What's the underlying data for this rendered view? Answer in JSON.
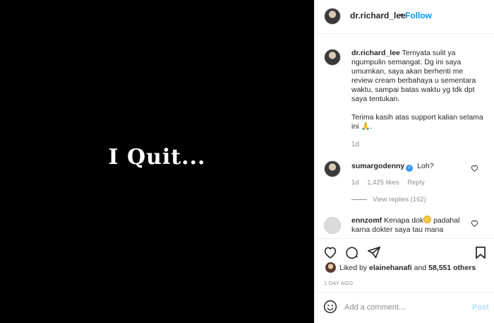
{
  "post_image": {
    "text": "I Quit..."
  },
  "header": {
    "username": "dr.richard_lee",
    "separator": "•",
    "follow_label": "Follow"
  },
  "caption": {
    "username": "dr.richard_lee",
    "text": "Ternyata sulit ya ngumpulin semangat. Dg ini saya umumkan, saya akan berhenti me review cream berbahaya u sementara waktu, sampai batas waktu yg tdk dpt saya tentukan.",
    "text2": "Terima kasih atas support kalian selama ini",
    "emoji": "🙏",
    "text2_end": ".",
    "time": "1d"
  },
  "comments": [
    {
      "username": "sumargodenny",
      "verified_mark": "✓",
      "text": "Loh?",
      "time": "1d",
      "likes": "1,425 likes",
      "reply_label": "Reply",
      "view_replies": "View replies (162)"
    },
    {
      "username": "ennzomf",
      "text_before": "Kenapa dok",
      "text_after": "padahal karna dokter saya tau mana"
    }
  ],
  "actions": {
    "likes_prefix": "Liked by",
    "likes_user": "elainehanafi",
    "likes_and": "and",
    "likes_count": "58,551 others",
    "time": "1 DAY AGO"
  },
  "comment_box": {
    "placeholder": "Add a comment...",
    "post_label": "Post"
  },
  "icons": {
    "like": "heart-icon",
    "comment": "comment-icon",
    "share": "share-icon",
    "save": "bookmark-icon",
    "emoji": "emoji-icon",
    "comment_like": "heart-outline-icon"
  },
  "colors": {
    "accent": "#0095f6",
    "post_disabled": "#b2dffc",
    "muted": "#8e8e8e",
    "image_bg": "#000000"
  }
}
